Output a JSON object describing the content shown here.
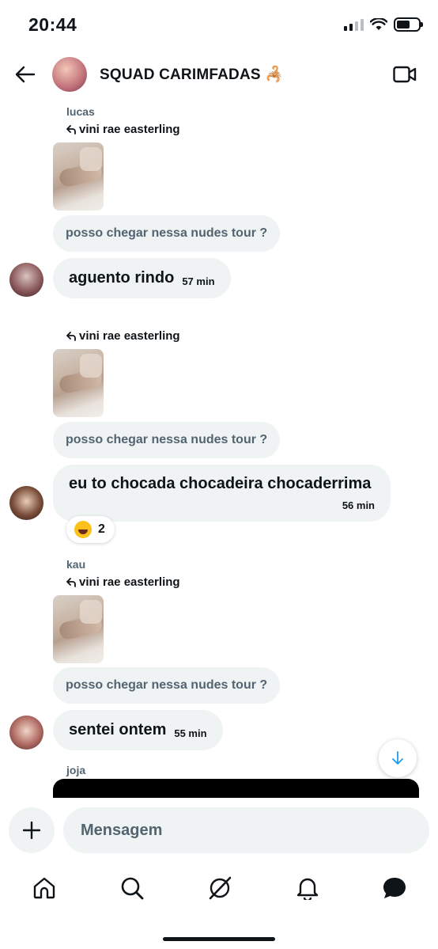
{
  "status": {
    "time": "20:44"
  },
  "header": {
    "title": "SQUAD CARIMFADAS 🦂"
  },
  "messages": [
    {
      "sender": "lucas",
      "reply_to": "vini rae easterling",
      "quoted": "posso chegar nessa nudes tour ?",
      "text": "aguento rindo",
      "time": "57 min"
    },
    {
      "sender": "",
      "reply_to": "vini rae easterling",
      "quoted": "posso chegar nessa nudes tour ?",
      "text": "eu to chocada chocadeira chocaderrima",
      "time": "56 min",
      "reaction": {
        "emoji": "😂",
        "count": "2"
      }
    },
    {
      "sender": "kau",
      "reply_to": "vini rae easterling",
      "quoted": "posso chegar nessa nudes tour ?",
      "text": "sentei ontem",
      "time": "55 min"
    },
    {
      "sender": "joja"
    }
  ],
  "composer": {
    "placeholder": "Mensagem"
  },
  "tabs": [
    "home",
    "search",
    "grok",
    "notifications",
    "messages"
  ],
  "colors": {
    "bubble": "#eff3f4",
    "muted": "#536471",
    "accent": "#1d9bf0"
  }
}
